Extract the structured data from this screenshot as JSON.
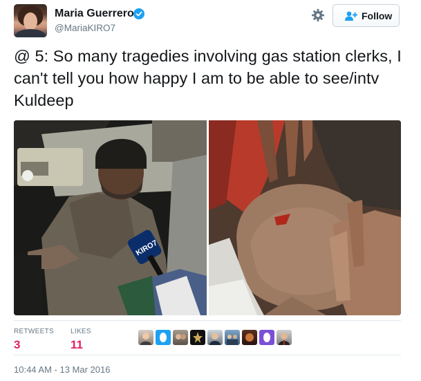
{
  "author": {
    "name": "Maria Guerrero",
    "handle": "@MariaKIRO7",
    "verified": true
  },
  "header": {
    "follow_label": "Follow"
  },
  "tweet": {
    "text": "@ 5: So many tragedies involving gas station clerks, I can't tell you how happy I am to be able to see/intv Kuldeep"
  },
  "media": {
    "left_mic_text": "KIRO7"
  },
  "stats": {
    "retweets_label": "RETWEETS",
    "retweets_count": "3",
    "likes_label": "LIKES",
    "likes_count": "11"
  },
  "footer": {
    "timestamp": "10:44 AM - 13 Mar 2016"
  },
  "colors": {
    "accent": "#1da1f2",
    "like_count": "#e0245e",
    "meta_text": "#657786",
    "border": "#e1e8ed"
  },
  "icons": {
    "settings": "gear-icon",
    "follow": "add-user-icon",
    "verified": "verified-badge-icon"
  }
}
